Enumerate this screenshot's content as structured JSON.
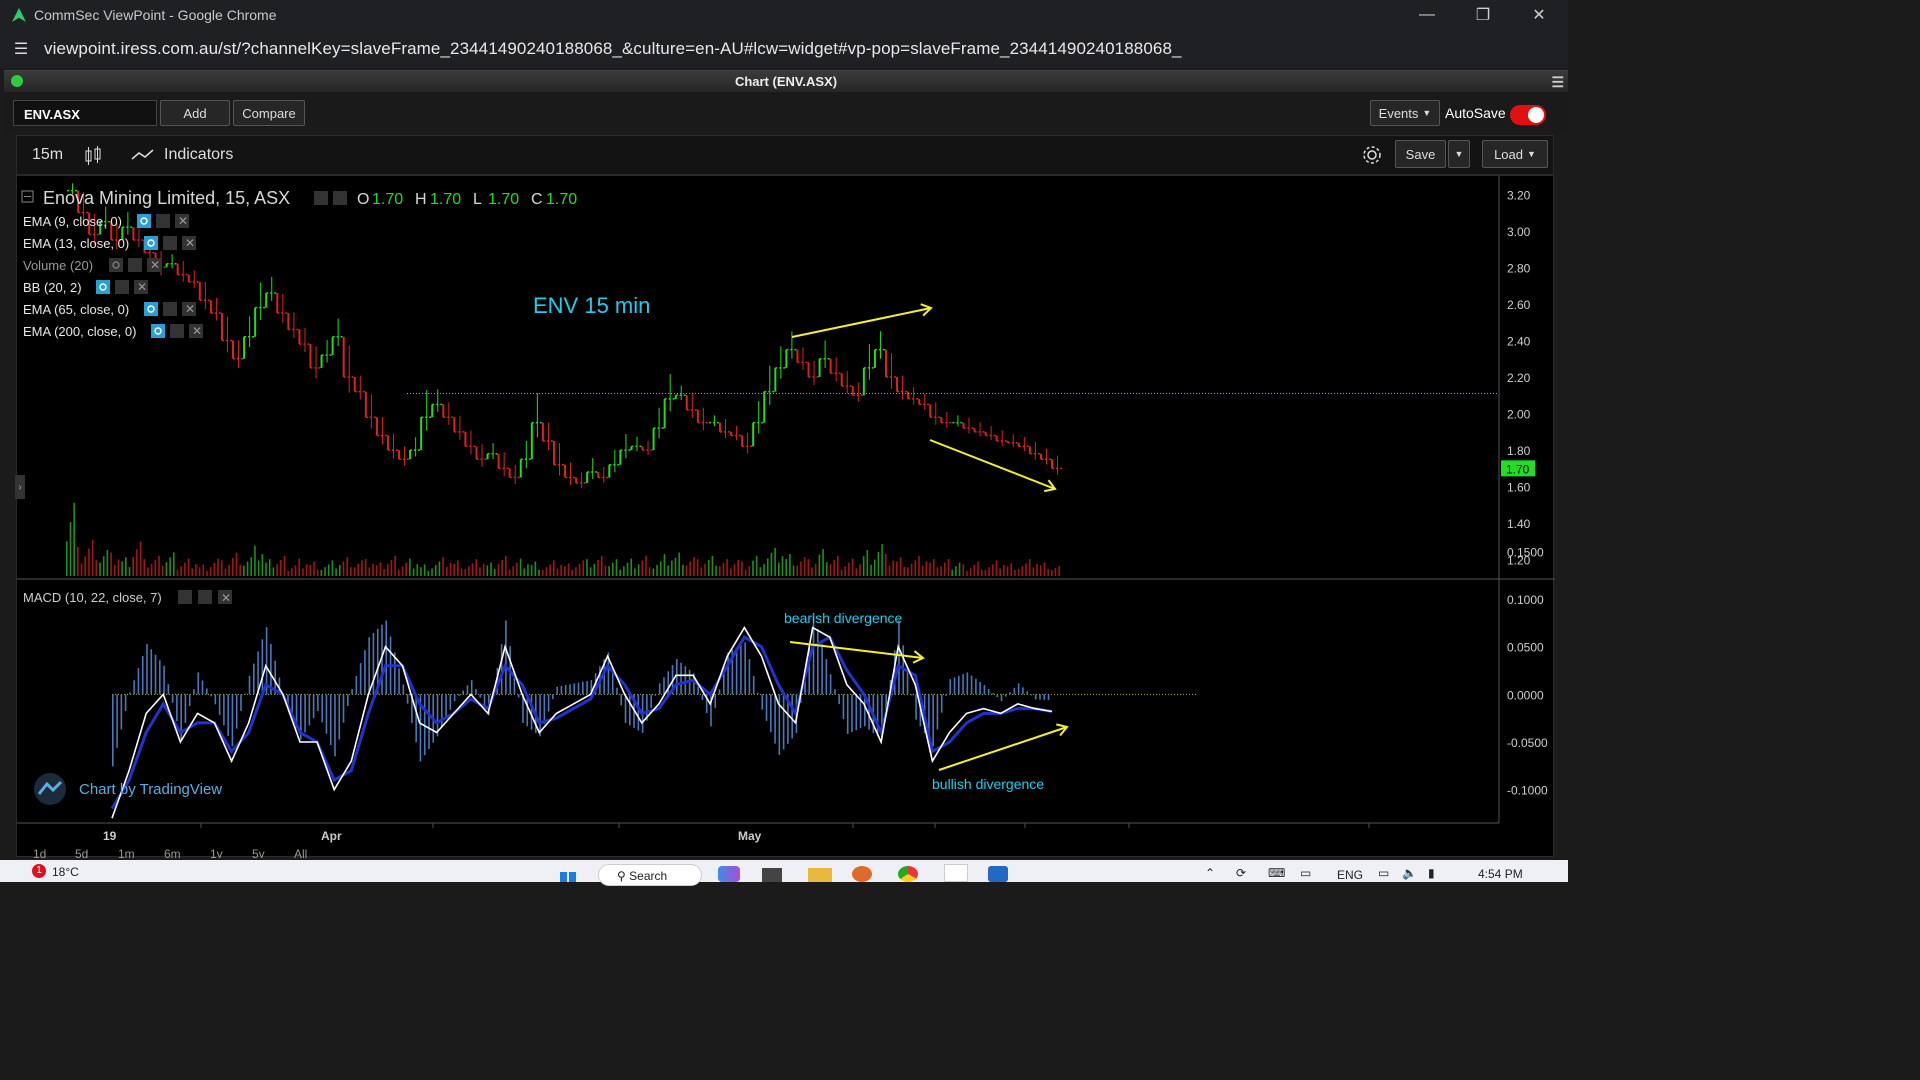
{
  "browser": {
    "title": "CommSec ViewPoint - Google Chrome",
    "url": "viewpoint.iress.com.au/st/?channelKey=slaveFrame_23441490240188068_&culture=en-AU#lcw=widget#vp-pop=slaveFrame_23441490240188068_"
  },
  "widget": {
    "title": "Chart (ENV.ASX)"
  },
  "toolbar": {
    "symbol": "ENV.ASX",
    "add_label": "Add",
    "compare_label": "Compare",
    "events_label": "Events",
    "autosave_label": "AutoSave",
    "autosave_on": true,
    "interval": "15m",
    "indicators_label": "Indicators",
    "save_label": "Save",
    "load_label": "Load"
  },
  "legend": {
    "title": "Enova Mining Limited, 15, ASX",
    "ohlc": [
      {
        "k": "O",
        "v": "1.70"
      },
      {
        "k": "H",
        "v": "1.70"
      },
      {
        "k": "L",
        "v": "1.70"
      },
      {
        "k": "C",
        "v": "1.70"
      }
    ],
    "studies": [
      "EMA (9, close, 0)",
      "EMA (13, close, 0)",
      "Volume (20)",
      "BB (20, 2)",
      "EMA (65, close, 0)",
      "EMA (200, close, 0)"
    ],
    "macd_label": "MACD (10, 22, close, 7)"
  },
  "annotations": {
    "main": "ENV 15 min",
    "bearish": "bearish divergence",
    "bullish": "bullish divergence",
    "watermark": "Chart by TradingView"
  },
  "bottom_ranges": [
    "1d",
    "5d",
    "1m",
    "6m",
    "1y",
    "5y",
    "All"
  ],
  "taskbar": {
    "temperature": "18°C",
    "search": "Search",
    "lang": "ENG",
    "time": "4:54 PM"
  },
  "colors": {
    "up": "#22dd22",
    "down": "#dd2222",
    "macd_line": "#ffffff",
    "signal_line": "#2233cc",
    "histogram": "#4a78b8",
    "annotation_arrow": "#f2f22a",
    "annotation_text": "#22ccee",
    "last_price_tag": "#22dd22"
  },
  "chart_data": [
    {
      "type": "line",
      "title": "Enova Mining Limited, 15, ASX",
      "ylim": [
        1.1,
        3.3
      ],
      "yticks": [
        3.2,
        3.0,
        2.8,
        2.6,
        2.4,
        2.2,
        2.0,
        1.8,
        1.6,
        1.4,
        1.2
      ],
      "ytick_labels": [
        "3.20",
        "3.00",
        "2.80",
        "2.60",
        "2.40",
        "2.20",
        "2.00",
        "1.80",
        "1.60",
        "1.40",
        "1.20"
      ],
      "x_labels": [
        "19",
        "Apr",
        "May"
      ],
      "last_price": 1.7,
      "last_price_label": "1.70",
      "reference_level": 2.11,
      "series": [
        {
          "close": [
            3.22,
            3.1,
            2.98,
            3.05,
            2.95,
            3.02,
            2.95,
            2.88,
            2.8,
            2.82,
            2.76,
            2.72,
            2.62,
            2.55,
            2.4,
            2.3,
            2.42,
            2.58,
            2.66,
            2.55,
            2.46,
            2.38,
            2.25,
            2.32,
            2.42,
            2.2,
            2.12,
            1.98,
            1.88,
            1.8,
            1.75,
            1.8,
            1.98,
            2.05,
            1.98,
            1.9,
            1.82,
            1.75,
            1.78,
            1.7,
            1.65,
            1.75,
            1.95,
            1.85,
            1.72,
            1.65,
            1.62,
            1.68,
            1.65,
            1.72,
            1.8,
            1.82,
            1.8,
            1.92,
            2.08,
            2.1,
            2.02,
            1.95,
            1.95,
            1.9,
            1.88,
            1.82,
            1.95,
            2.12,
            2.25,
            2.35,
            2.28,
            2.2,
            2.3,
            2.22,
            2.15,
            2.1,
            2.25,
            2.35,
            2.2,
            2.12,
            2.08,
            2.05,
            1.98,
            1.95,
            1.95,
            1.92,
            1.9,
            1.88,
            1.85,
            1.84,
            1.82,
            1.78,
            1.75,
            1.7
          ]
        }
      ],
      "volume": [
        0.55,
        0.2,
        0.25,
        0.18,
        0.15,
        0.12,
        0.22,
        0.1,
        0.12,
        0.14,
        0.1,
        0.12,
        0.08,
        0.12,
        0.1,
        0.15,
        0.12,
        0.18,
        0.1,
        0.12,
        0.08,
        0.12,
        0.1,
        0.08,
        0.1,
        0.12,
        0.1,
        0.1,
        0.08,
        0.12,
        0.1,
        0.12,
        0.08,
        0.1,
        0.12,
        0.1,
        0.08,
        0.1,
        0.08,
        0.12,
        0.1,
        0.12,
        0.1,
        0.08,
        0.1,
        0.08,
        0.1,
        0.1,
        0.12,
        0.1,
        0.1,
        0.12,
        0.14,
        0.1,
        0.14,
        0.15,
        0.12,
        0.1,
        0.12,
        0.1,
        0.12,
        0.1,
        0.14,
        0.16,
        0.18,
        0.14,
        0.12,
        0.1,
        0.16,
        0.12,
        0.1,
        0.12,
        0.18,
        0.22,
        0.14,
        0.12,
        0.1,
        0.12,
        0.1,
        0.1,
        0.1,
        0.08,
        0.1,
        0.08,
        0.1,
        0.08,
        0.08,
        0.1,
        0.08,
        0.06
      ]
    },
    {
      "type": "line",
      "title": "MACD (10, 22, close, 7)",
      "ylim": [
        -0.135,
        0.12
      ],
      "yticks": [
        0.15,
        0.1,
        0.05,
        0.0,
        -0.05,
        -0.1
      ],
      "ytick_labels": [
        "0.1500",
        "0.1000",
        "0.0500",
        "0.0000",
        "-0.0500",
        "-0.1000"
      ],
      "series": [
        {
          "name": "MACD",
          "values": [
            -0.13,
            -0.08,
            -0.02,
            0.0,
            -0.05,
            -0.02,
            -0.03,
            -0.07,
            -0.03,
            0.03,
            0.0,
            -0.05,
            -0.05,
            -0.1,
            -0.07,
            0.0,
            0.05,
            0.03,
            -0.03,
            -0.04,
            -0.02,
            0.0,
            -0.02,
            0.05,
            0.0,
            -0.04,
            -0.02,
            -0.01,
            0.0,
            0.04,
            0.0,
            -0.03,
            -0.01,
            0.02,
            0.02,
            -0.01,
            0.04,
            0.07,
            0.04,
            -0.01,
            -0.03,
            0.07,
            0.06,
            0.01,
            -0.01,
            -0.05,
            0.05,
            0.01,
            -0.07,
            -0.04,
            -0.02,
            -0.015,
            -0.02,
            -0.01,
            -0.015,
            -0.018
          ]
        },
        {
          "name": "Signal",
          "values": [
            -0.12,
            -0.09,
            -0.04,
            -0.01,
            -0.04,
            -0.03,
            -0.03,
            -0.06,
            -0.04,
            0.01,
            0.0,
            -0.04,
            -0.05,
            -0.09,
            -0.08,
            -0.02,
            0.03,
            0.03,
            -0.01,
            -0.03,
            -0.02,
            -0.005,
            -0.015,
            0.03,
            0.01,
            -0.03,
            -0.025,
            -0.015,
            -0.005,
            0.03,
            0.01,
            -0.02,
            -0.015,
            0.01,
            0.015,
            0.0,
            0.03,
            0.06,
            0.05,
            0.01,
            -0.02,
            0.05,
            0.06,
            0.025,
            0.0,
            -0.04,
            0.03,
            0.02,
            -0.06,
            -0.05,
            -0.03,
            -0.02,
            -0.02,
            -0.015,
            -0.015,
            -0.018
          ]
        }
      ]
    }
  ]
}
